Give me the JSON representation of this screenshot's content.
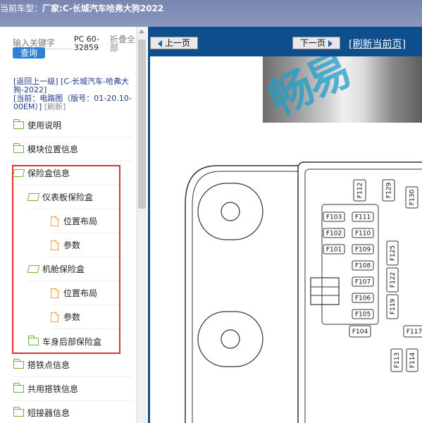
{
  "topbar": {
    "label": "当前车型：",
    "maker": "厂家:C-长城汽车哈弗大狗2022"
  },
  "left": {
    "search_placeholder": "输入关键字",
    "query_label": "查询",
    "pc_text": "PC 60-32859",
    "fold_label": "折叠全部",
    "back_link": "[返回上一级]",
    "model": "[C-长城汽车-哈弗大狗-2022]",
    "current": "[当前：电路图（版号：01-20.10-00EM）]",
    "refresh": "[刷新]",
    "tree": [
      {
        "label": "使用说明",
        "type": "folder"
      },
      {
        "label": "模块位置信息",
        "type": "folder"
      },
      {
        "label": "保险盒信息",
        "type": "folder-open"
      },
      {
        "label": "仪表板保险盒",
        "type": "folder-open"
      },
      {
        "label": "位置布局",
        "type": "file"
      },
      {
        "label": "参数",
        "type": "file"
      },
      {
        "label": "机舱保险盒",
        "type": "folder-open"
      },
      {
        "label": "位置布局",
        "type": "file"
      },
      {
        "label": "参数",
        "type": "file"
      },
      {
        "label": "车身后部保险盒",
        "type": "folder"
      },
      {
        "label": "搭铁点信息",
        "type": "folder"
      },
      {
        "label": "共用搭铁信息",
        "type": "folder"
      },
      {
        "label": "短接器信息",
        "type": "folder"
      }
    ]
  },
  "nav": {
    "prev": "上一页",
    "next": "下一页",
    "refresh": "[刷新当前页]"
  },
  "view": {
    "watermark": "畅易",
    "fuses": [
      "F112",
      "F129",
      "F130",
      "F103",
      "F111",
      "F102",
      "F110",
      "F101",
      "F109",
      "F125",
      "F108",
      "F107",
      "F122",
      "F106",
      "F119",
      "F105",
      "F104",
      "F117",
      "F113",
      "F114"
    ]
  },
  "colors": {
    "nav": "#0d4f8c",
    "highlight": "#e03030",
    "folder": "#6cb33f",
    "file": "#f0a040",
    "query": "#2e7fd6"
  }
}
